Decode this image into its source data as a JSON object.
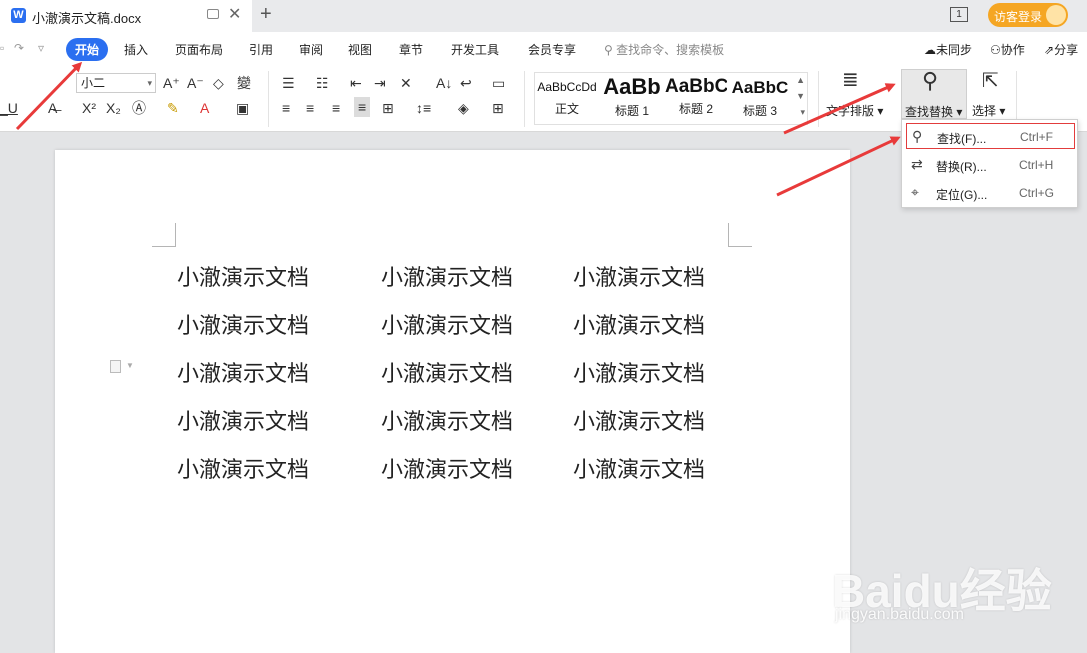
{
  "titlebar": {
    "doc_title": "小澈演示文稿.docx",
    "app_icon_letter": "W",
    "window_num": "1",
    "login_label": "访客登录"
  },
  "menu": {
    "tabs": [
      "开始",
      "插入",
      "页面布局",
      "引用",
      "审阅",
      "视图",
      "章节",
      "开发工具",
      "会员专享"
    ],
    "search_placeholder": "查找命令、搜索模板",
    "right": [
      "未同步",
      "协作",
      "分享"
    ]
  },
  "ribbon": {
    "font_size": "小二",
    "styles": [
      {
        "sample": "AaBbCcDd",
        "label": "正文"
      },
      {
        "sample": "AaBb",
        "label": "标题 1"
      },
      {
        "sample": "AaBbC",
        "label": "标题 2"
      },
      {
        "sample": "AaBbC",
        "label": "标题 3"
      }
    ],
    "text_layout_label": "文字排版",
    "find_replace_label": "查找替换",
    "select_label": "选择"
  },
  "document": {
    "cell_text": "小澈演示文档",
    "rows": [
      [
        "小澈演示文档",
        "小澈演示文档",
        "小澈演示文档"
      ],
      [
        "小澈演示文档",
        "小澈演示文档",
        "小澈演示文档"
      ],
      [
        "小澈演示文档",
        "小澈演示文档",
        "小澈演示文档"
      ],
      [
        "小澈演示文档",
        "小澈演示文档",
        "小澈演示文档"
      ],
      [
        "小澈演示文档",
        "小澈演示文档",
        "小澈演示文档"
      ]
    ]
  },
  "dropdown": {
    "items": [
      {
        "label": "查找(F)...",
        "shortcut": "Ctrl+F",
        "icon": "search-icon"
      },
      {
        "label": "替换(R)...",
        "shortcut": "Ctrl+H",
        "icon": "replace-icon"
      },
      {
        "label": "定位(G)...",
        "shortcut": "Ctrl+G",
        "icon": "goto-icon"
      }
    ]
  },
  "watermark": {
    "brand": "Baidu经验",
    "url": "jingyan.baidu.com"
  },
  "colors": {
    "accent": "#2b6ff0",
    "annotation_arrow": "#e83a3a",
    "highlight_border": "#e23c3c",
    "login_button": "#f5a623"
  }
}
